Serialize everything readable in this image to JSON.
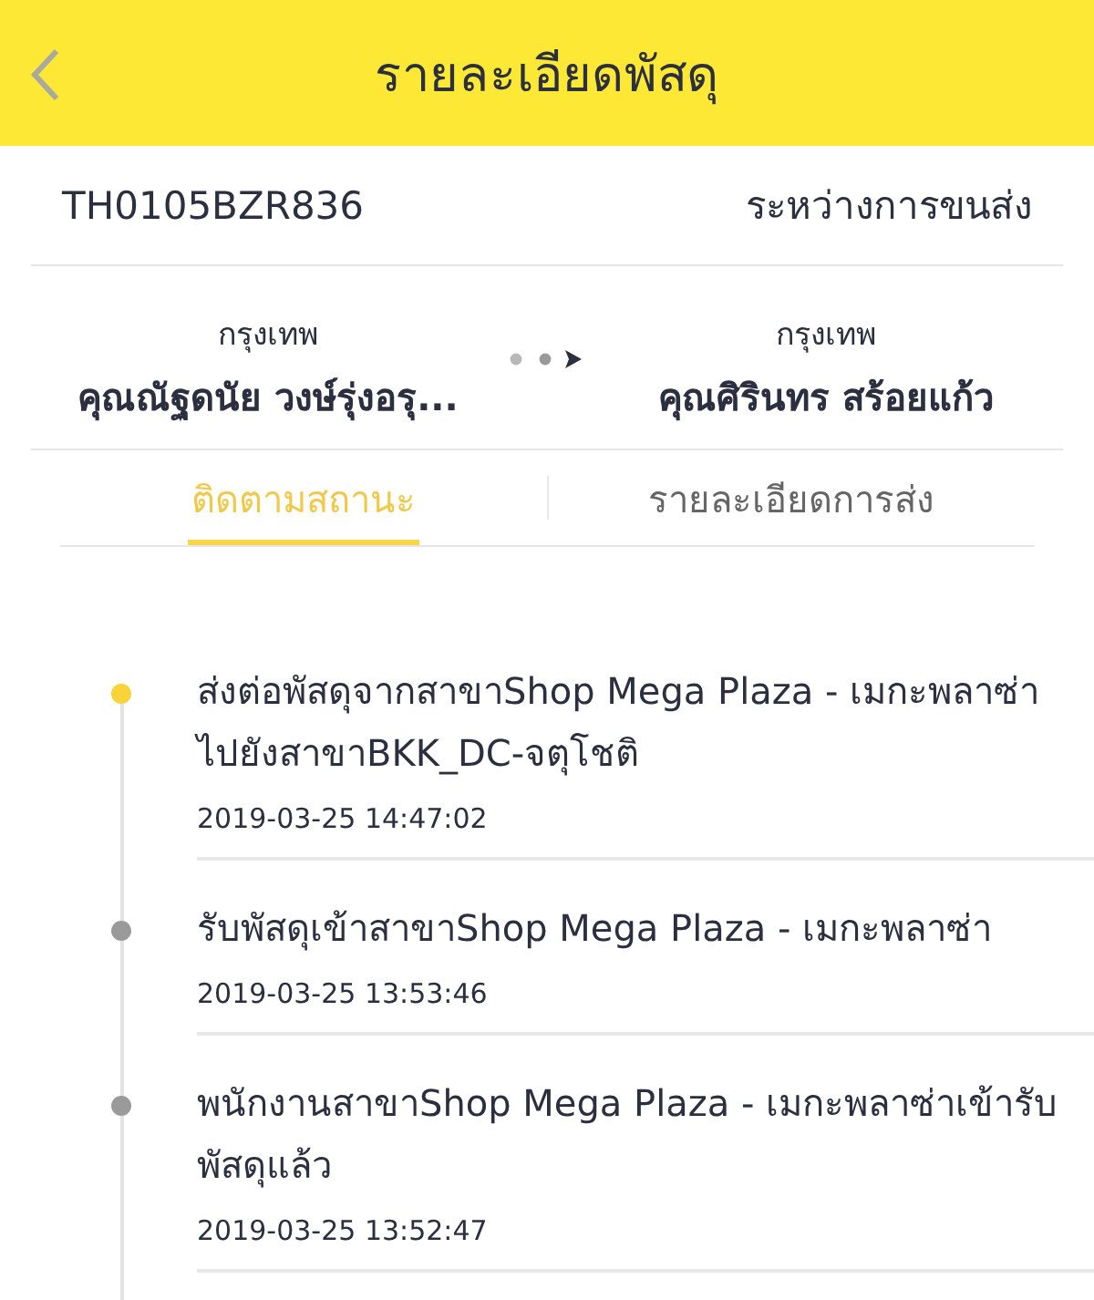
{
  "header": {
    "title": "รายละเอียดพัสดุ"
  },
  "parcel": {
    "tracking_number": "TH0105BZR836",
    "status": "ระหว่างการขนส่ง"
  },
  "route": {
    "sender": {
      "city": "กรุงเทพ",
      "name": "คุณณัฐดนัย  วงษ์รุ่งอรุ..."
    },
    "recipient": {
      "city": "กรุงเทพ",
      "name": "คุณศิรินทร สร้อยแก้ว"
    }
  },
  "tabs": [
    {
      "label": "ติดตามสถานะ",
      "selected": true
    },
    {
      "label": "รายละเอียดการส่ง",
      "selected": false
    }
  ],
  "timeline": [
    {
      "text": "ส่งต่อพัสดุจากสาขาShop Mega Plaza - เมกะพลาซ่า ไปยังสาขาBKK_DC-จตุโชติ",
      "time": "2019-03-25 14:47:02",
      "current": true
    },
    {
      "text": "รับพัสดุเข้าสาขาShop Mega Plaza - เมกะพลาซ่า",
      "time": "2019-03-25 13:53:46",
      "current": false
    },
    {
      "text": "พนักงานสาขาShop Mega Plaza - เมกะพลาซ่าเข้ารับพัสดุแล้ว",
      "time": "2019-03-25 13:52:47",
      "current": false
    }
  ]
}
